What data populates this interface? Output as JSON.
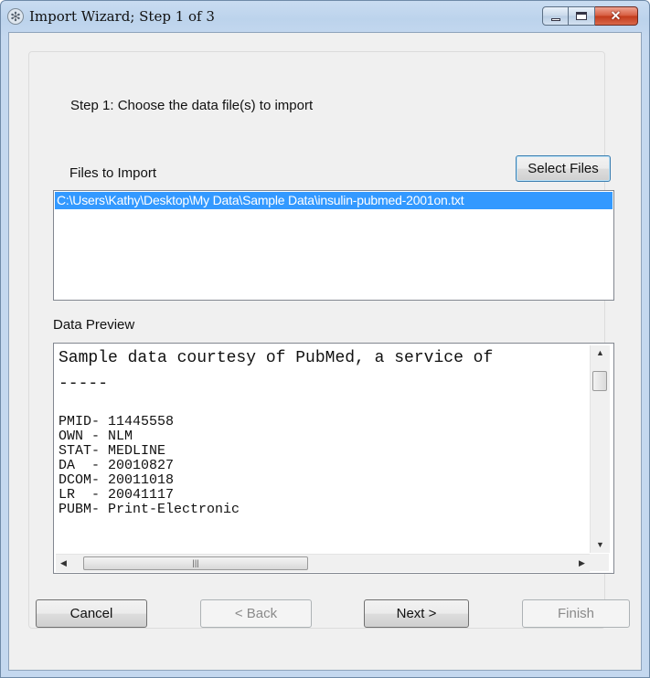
{
  "window": {
    "title": "Import Wizard; Step 1 of 3"
  },
  "step_label": "Step 1: Choose the data file(s) to import",
  "files": {
    "label": "Files to Import",
    "select_button": "Select Files",
    "items": [
      "C:\\Users\\Kathy\\Desktop\\My Data\\Sample Data\\insulin-pubmed-2001on.txt"
    ]
  },
  "preview": {
    "label": "Data Preview",
    "header_line": "Sample data courtesy of PubMed, a service of",
    "separator": "-----",
    "lines": [
      "PMID- 11445558",
      "OWN - NLM",
      "STAT- MEDLINE",
      "DA  - 20010827",
      "DCOM- 20011018",
      "LR  - 20041117",
      "PUBM- Print-Electronic"
    ],
    "scroll_glyphs": {
      "up": "▲",
      "down": "▼",
      "left": "◀",
      "right": "▶",
      "grip": "|||"
    }
  },
  "buttons": {
    "cancel": "Cancel",
    "back": "< Back",
    "next": "Next >",
    "finish": "Finish"
  },
  "caption_glyphs": {
    "close": "✕",
    "app_icon": "✻"
  },
  "colors": {
    "selection": "#3399ff",
    "title_bar": "#c4d8ef",
    "close_button": "#c23a1a"
  }
}
